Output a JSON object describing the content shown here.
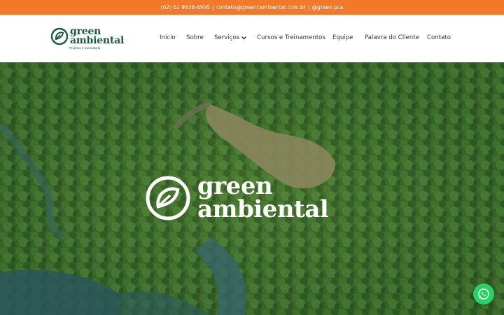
{
  "topbar": {
    "phone": "(62) 62 9958-6995",
    "sep1": "|",
    "email": "contato@greencambiental.com.br",
    "sep2": "|",
    "instagram": "@green.pca",
    "bg_color": "#f3792a"
  },
  "brand": {
    "word1": "green",
    "word2": "ambiental",
    "tagline": "Projetos e Consultoria",
    "color": "#1c5a3a",
    "icon": "leaf-circle-logo-icon"
  },
  "nav": {
    "items": [
      {
        "label": "Início"
      },
      {
        "label": "Sobre"
      },
      {
        "label": "Serviços",
        "icon": "chevron-down-icon"
      },
      {
        "label": "Cursos e Treinamentos"
      },
      {
        "label": "Equipe"
      },
      {
        "label": "Palavra do Cliente"
      },
      {
        "label": "Contato"
      }
    ]
  },
  "hero": {
    "word1": "green",
    "word2": "ambiental",
    "background": "aerial-forest-photo"
  },
  "whatsapp": {
    "icon": "whatsapp-icon",
    "color": "#25d366"
  }
}
